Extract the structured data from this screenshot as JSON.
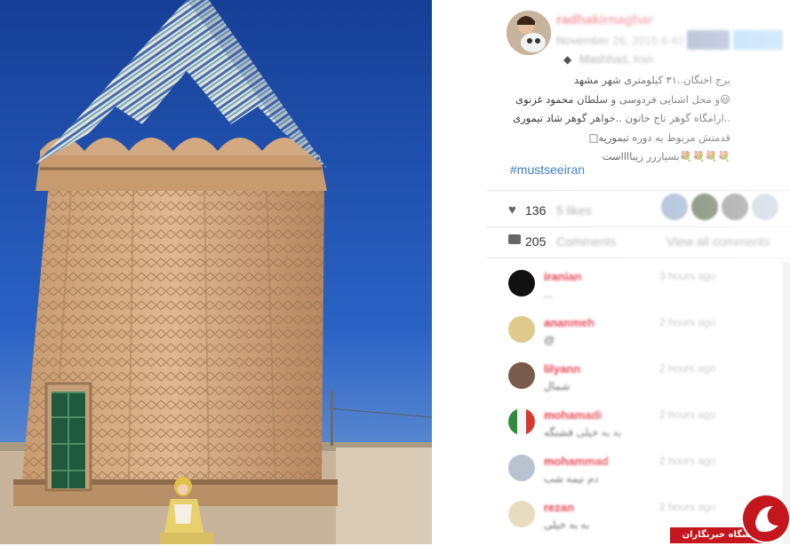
{
  "post": {
    "username": "radhakirnaghar",
    "date": "November 26, 2015 6:40",
    "location": "Mashhad, Iran",
    "caption_lines": [
      "برج اخنگان..۳۱ کیلومتری شهر مشهد",
      "😃و محل اشنایی فردوسی و سلطان محمود غزنوی",
      "..ارامگاه گوهر تاج خاتون ..خواهر گوهر شاد تیموری",
      "قدمتش مربوط به دوره تیموریه□",
      "💐💐💐💐بسیاررر زیبااااست"
    ],
    "hashtag": "#mustseeiran",
    "likes_count": "136",
    "likes_suffix": "5 likes",
    "comments_count": "205",
    "comments_suffix": "Comments",
    "view_all": "View all comments"
  },
  "comments": [
    {
      "user": "iranian",
      "time": "3 hours ago",
      "text": "..."
    },
    {
      "user": "ananmeh",
      "time": "2 hours ago",
      "text": "@"
    },
    {
      "user": "lilyann",
      "time": "2 hours ago",
      "text": "شمال"
    },
    {
      "user": "mohamadi",
      "time": "2 hours ago",
      "text": "به به خیلی قشنگه"
    },
    {
      "user": "mohammad",
      "time": "2 hours ago",
      "text": "دم نیمه شب"
    },
    {
      "user": "rezan",
      "time": "2 hours ago",
      "text": "به به خیلی"
    }
  ],
  "watermark": {
    "text": "باشگاه خبرنگاران"
  },
  "colors": {
    "sky": "#1f4fb0",
    "brick": "#c9a27a",
    "accent_red": "#e43a4d",
    "link_blue": "#3a7bc8"
  }
}
